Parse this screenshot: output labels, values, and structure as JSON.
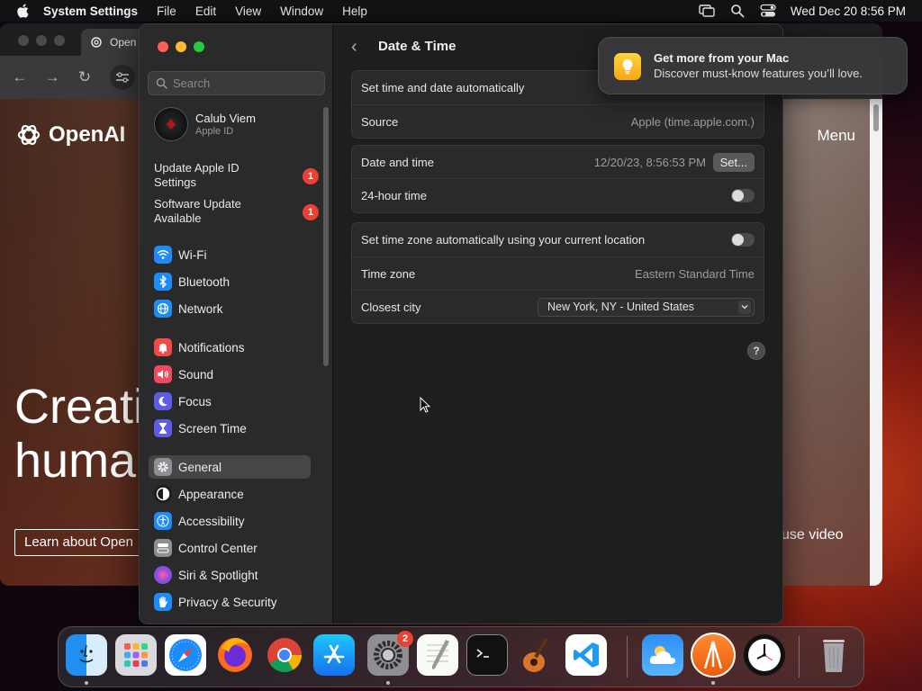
{
  "menubar": {
    "app_name": "System Settings",
    "items": [
      "File",
      "Edit",
      "View",
      "Window",
      "Help"
    ],
    "clock": "Wed Dec 20  8:56 PM"
  },
  "browser": {
    "tab_title": "Open",
    "logo_text": "OpenAI",
    "menu_label": "Menu",
    "hero_line1": "Creati",
    "hero_line2": "huma",
    "learn_button": "Learn about Open",
    "pause_video": "use video"
  },
  "settings": {
    "search_placeholder": "Search",
    "profile": {
      "name": "Calub Viem",
      "subtitle": "Apple ID"
    },
    "notices": [
      {
        "label": "Update Apple ID Settings",
        "badge": "1"
      },
      {
        "label": "Software Update Available",
        "badge": "1"
      }
    ],
    "sidebar": [
      {
        "label": "Wi-Fi",
        "icon": "wifi-icon",
        "color": "#1d8cf8"
      },
      {
        "label": "Bluetooth",
        "icon": "bluetooth-icon",
        "color": "#1d8cf8"
      },
      {
        "label": "Network",
        "icon": "globe-icon",
        "color": "#1d8cf8"
      },
      {
        "label": "Notifications",
        "icon": "bell-icon",
        "color": "#ee4b46"
      },
      {
        "label": "Sound",
        "icon": "speaker-icon",
        "color": "#ee4b5e"
      },
      {
        "label": "Focus",
        "icon": "moon-icon",
        "color": "#5e5ce6"
      },
      {
        "label": "Screen Time",
        "icon": "hourglass-icon",
        "color": "#5e5ce6"
      },
      {
        "label": "General",
        "icon": "gear-icon",
        "color": "#8e8e93"
      },
      {
        "label": "Appearance",
        "icon": "appearance-icon",
        "color": "#1c1c1e"
      },
      {
        "label": "Accessibility",
        "icon": "accessibility-icon",
        "color": "#1d8cf8"
      },
      {
        "label": "Control Center",
        "icon": "control-center-icon",
        "color": "#8e8e93"
      },
      {
        "label": "Siri & Spotlight",
        "icon": "siri-icon",
        "color": "#b44ae0"
      },
      {
        "label": "Privacy & Security",
        "icon": "hand-icon",
        "color": "#1d8cf8"
      }
    ],
    "active_item": "General",
    "detail": {
      "title": "Date & Time",
      "auto_time_label": "Set time and date automatically",
      "source_label": "Source",
      "source_value": "Apple (time.apple.com.)",
      "date_time_label": "Date and time",
      "date_time_value": "12/20/23, 8:56:53 PM",
      "set_button": "Set...",
      "hour24_label": "24-hour time",
      "auto_tz_label": "Set time zone automatically using your current location",
      "timezone_label": "Time zone",
      "timezone_value": "Eastern Standard Time",
      "closest_city_label": "Closest city",
      "closest_city_value": "New York, NY - United States",
      "help": "?"
    }
  },
  "notification": {
    "title": "Get more from your Mac",
    "body": "Discover must-know features you’ll love."
  },
  "dock": {
    "settings_badge": "2"
  }
}
